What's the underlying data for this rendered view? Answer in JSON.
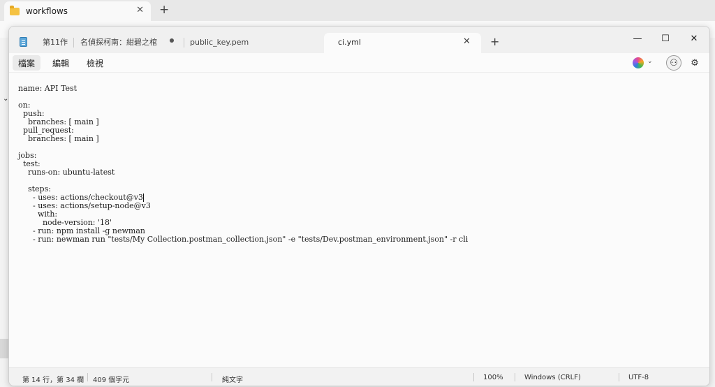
{
  "explorer": {
    "tab_title": "workflows",
    "close_glyph": "✕",
    "new_tab_glyph": "+"
  },
  "notepad": {
    "tabs": [
      {
        "label": "第11作"
      },
      {
        "label": "名偵探柯南：紺碧之棺"
      },
      {
        "label": "public_key.pem"
      },
      {
        "label": "ci.yml"
      }
    ],
    "close_glyph": "✕",
    "new_tab_glyph": "+",
    "window_controls": {
      "minimize": "—",
      "maximize": "☐",
      "close": "✕"
    },
    "menu": {
      "file": "檔案",
      "edit": "編輯",
      "view": "檢視"
    },
    "icons": {
      "copilot": "copilot-icon",
      "chevron": "⌄",
      "user": "⚇",
      "settings": "⚙"
    },
    "editor": {
      "before_cursor": "name: API Test\n\non:\n  push:\n    branches: [ main ]\n  pull_request:\n    branches: [ main ]\n\njobs:\n  test:\n    runs-on: ubuntu-latest\n\n    steps:\n      - uses: actions/checkout@v3",
      "after_cursor": "\n      - uses: actions/setup-node@v3\n        with:\n          node-version: '18'\n      - run: npm install -g newman\n      - run: newman run \"tests/My Collection.postman_collection.json\" -e \"tests/Dev.postman_environment.json\" -r cli"
    },
    "status": {
      "position": "第 14 行，第 34 欄",
      "chars": "409 個字元",
      "format": "純文字",
      "zoom": "100%",
      "line_ending": "Windows (CRLF)",
      "encoding": "UTF-8"
    }
  }
}
